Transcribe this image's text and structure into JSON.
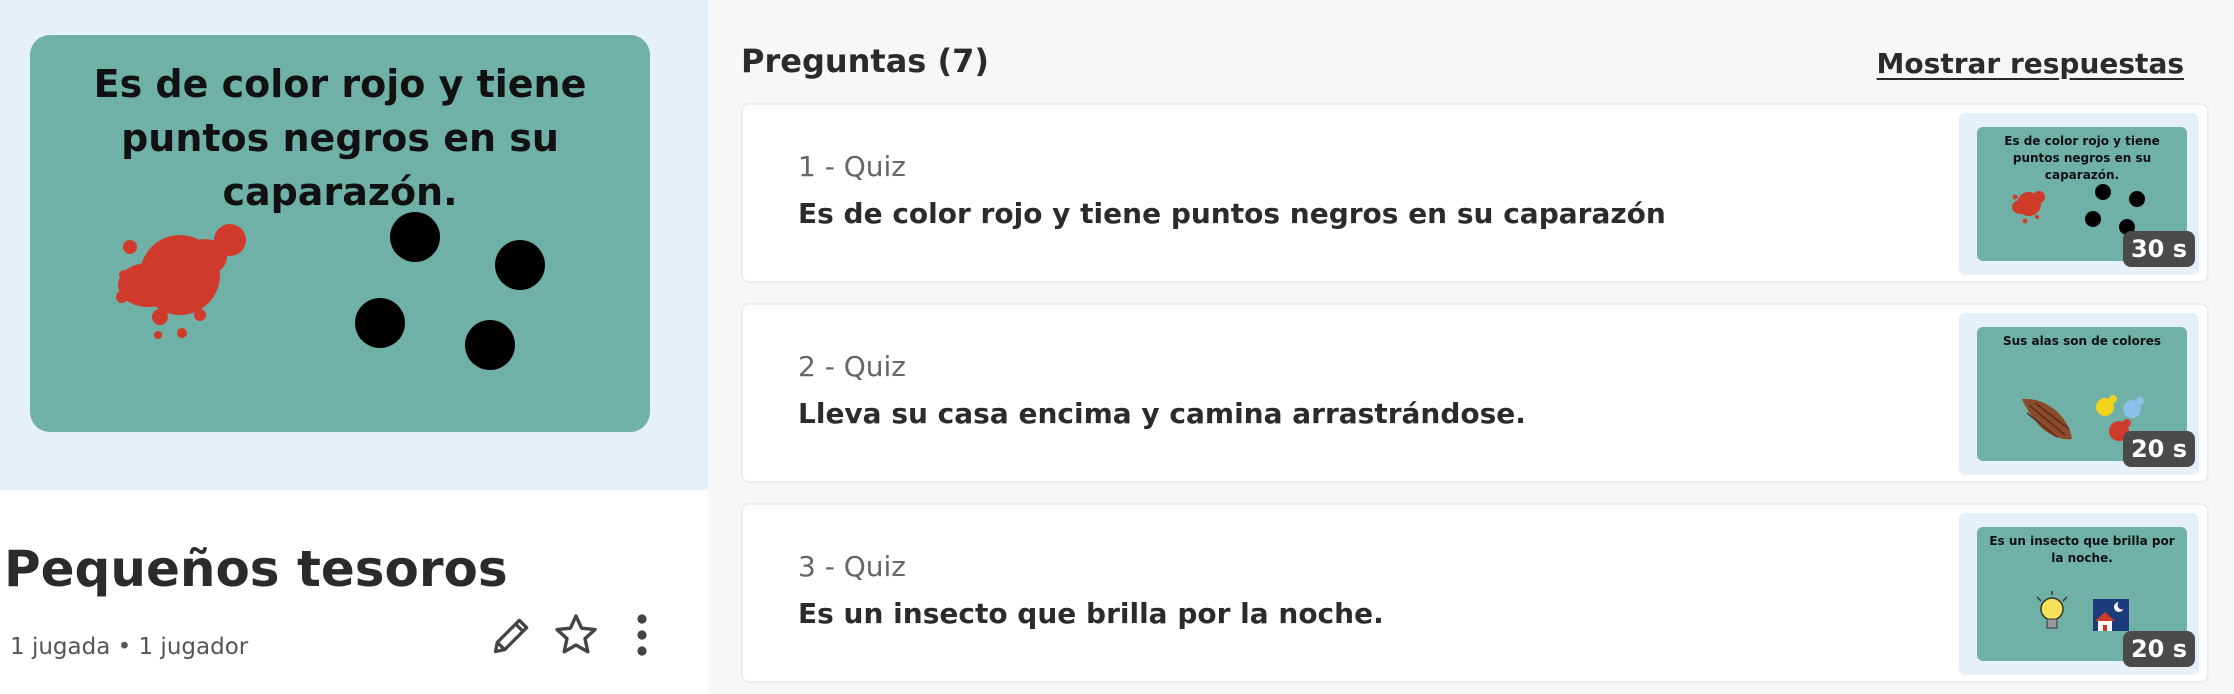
{
  "cover": {
    "text": "Es de color rojo y tiene puntos negros en su caparazón.",
    "background_color": "#6fb1a7"
  },
  "quiz": {
    "title": "Pequeños tesoros",
    "meta": "1 jugada • 1 jugador",
    "actions": {
      "edit_icon": "pencil-icon",
      "favorite_icon": "star-icon",
      "more_icon": "more-vertical-icon"
    }
  },
  "questions_panel": {
    "heading": "Preguntas (7)",
    "show_answers_label": "Mostrar respuestas",
    "items": [
      {
        "type": "1 - Quiz",
        "text": "Es de color rojo y tiene puntos negros en su caparazón",
        "thumb_text": "Es de color rojo y tiene puntos negros en su caparazón.",
        "time": "30 s"
      },
      {
        "type": "2 - Quiz",
        "text": "Lleva su casa encima y camina arrastrándose.",
        "thumb_text": "Sus alas son de colores",
        "time": "20 s"
      },
      {
        "type": "3 - Quiz",
        "text": "Es un insecto que brilla por la noche.",
        "thumb_text": "Es un insecto que brilla por la noche.",
        "time": "20 s"
      }
    ]
  },
  "colors": {
    "accent_blue": "#e6f0f9",
    "card_green": "#6fb1a7",
    "splash_red": "#d03a2b",
    "badge_dark": "#4a4a4a"
  }
}
